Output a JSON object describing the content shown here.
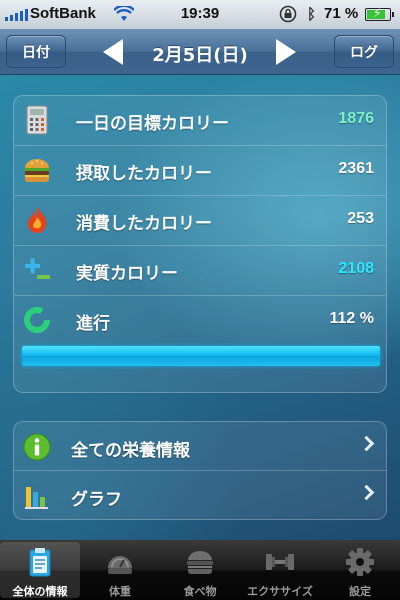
{
  "status_bar": {
    "carrier": "SoftBank",
    "time": "19:39",
    "battery": "71 %"
  },
  "nav": {
    "left_button": "日付",
    "title": "2月5日(日)",
    "right_button": "ログ"
  },
  "stats": [
    {
      "label": "一日の目標カロリー",
      "value": "1876",
      "value_color": "#7ef0c8",
      "icon": "calculator-icon"
    },
    {
      "label": "摂取したカロリー",
      "value": "2361",
      "value_color": "#ffffff",
      "icon": "burger-icon"
    },
    {
      "label": "消費したカロリー",
      "value": "253",
      "value_color": "#ffffff",
      "icon": "flame-icon"
    },
    {
      "label": "実質カロリー",
      "value": "2108",
      "value_color": "#2ee6ff",
      "icon": "plus-minus-icon"
    },
    {
      "label": "進行",
      "value": "112 %",
      "value_color": "#ffffff",
      "icon": "progress-ring-icon"
    }
  ],
  "progress": {
    "fraction": 1.0,
    "color": "#18c4f6"
  },
  "links": [
    {
      "label": "全ての栄養情報",
      "icon": "info-icon"
    },
    {
      "label": "グラフ",
      "icon": "bar-graph-icon"
    }
  ],
  "tabs": [
    {
      "label": "全体の情報",
      "icon": "clipboard-icon",
      "active": true
    },
    {
      "label": "体重",
      "icon": "scale-icon",
      "active": false
    },
    {
      "label": "食べ物",
      "icon": "burger-icon",
      "active": false
    },
    {
      "label": "エクササイズ",
      "icon": "dumbbell-icon",
      "active": false
    },
    {
      "label": "設定",
      "icon": "gear-icon",
      "active": false
    }
  ]
}
